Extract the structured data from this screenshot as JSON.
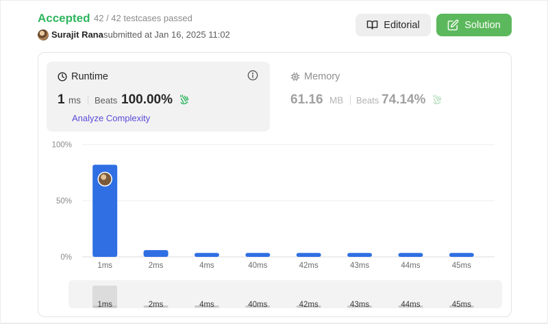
{
  "header": {
    "status": "Accepted",
    "status_color": "#2db55d",
    "testcases": "42 / 42 testcases passed",
    "user": "Surajit Rana",
    "submitted": "submitted at Jan 16, 2025 11:02"
  },
  "buttons": {
    "editorial": "Editorial",
    "solution": "Solution"
  },
  "runtime": {
    "title": "Runtime",
    "value": "1",
    "unit": "ms",
    "beats_label": "Beats",
    "beats_value": "100.00%",
    "analyze": "Analyze Complexity"
  },
  "memory": {
    "title": "Memory",
    "value": "61.16",
    "unit": "MB",
    "beats_label": "Beats",
    "beats_value": "74.14%"
  },
  "icons": {
    "clock": "clock-icon",
    "chip": "chip-icon",
    "info": "info-icon",
    "book": "book-icon",
    "edit": "edit-icon",
    "clap": "clap-icon"
  },
  "chart_data": {
    "type": "bar",
    "categories": [
      "1ms",
      "2ms",
      "4ms",
      "40ms",
      "42ms",
      "43ms",
      "44ms",
      "45ms"
    ],
    "values": [
      82,
      6,
      3.5,
      3.5,
      3.5,
      3.5,
      3.5,
      3.5
    ],
    "y_tick_labels": [
      "100%",
      "50%",
      "0%"
    ],
    "ylim": [
      0,
      100
    ],
    "grid": true,
    "highlight_category": "1ms",
    "bar_color": "#2f6fe3",
    "navigator": {
      "categories": [
        "1ms",
        "2ms",
        "4ms",
        "40ms",
        "42ms",
        "43ms",
        "44ms",
        "45ms"
      ]
    }
  }
}
